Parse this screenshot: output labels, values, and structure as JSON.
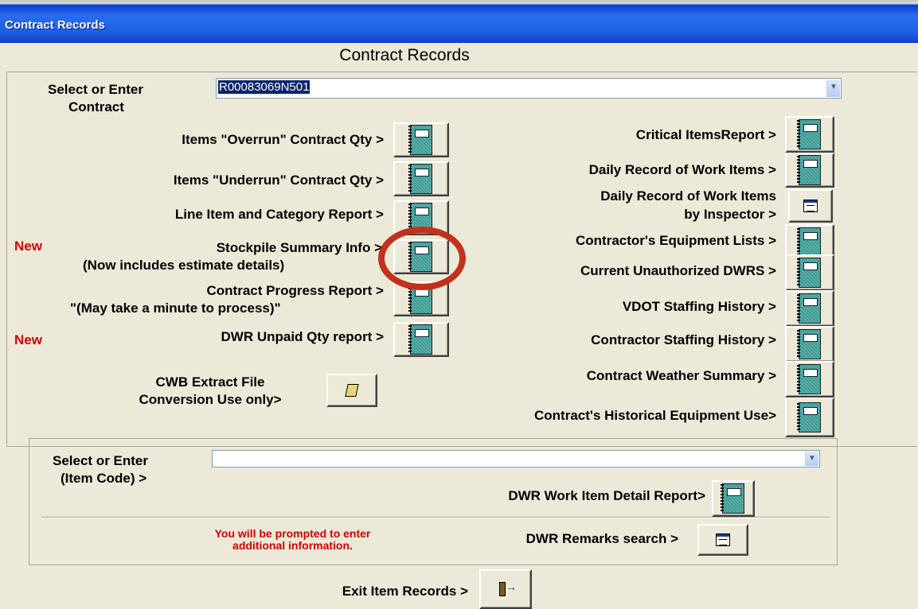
{
  "window": {
    "title": "Contract Records"
  },
  "form": {
    "heading": "Contract Records"
  },
  "contract_select": {
    "label_line1": "Select or Enter",
    "label_line2": "Contract",
    "value": "R00083069N501"
  },
  "left_buttons": {
    "overrun": "Items \"Overrun\" Contract Qty >",
    "underrun": "Items \"Underrun\" Contract Qty >",
    "line_item": "Line Item and Category Report >",
    "stockpile_line1": "Stockpile Summary Info >",
    "stockpile_line2": "(Now includes estimate details)",
    "progress_line1": "Contract Progress Report >",
    "progress_line2": "\"(May take a minute to process)\"",
    "unpaid": "DWR Unpaid Qty report >",
    "cwb_line1": "CWB Extract File",
    "cwb_line2": "Conversion Use only>"
  },
  "badges": {
    "new1": "New",
    "new2": "New"
  },
  "right_buttons": {
    "critical": "Critical ItemsReport >",
    "daily": "Daily Record of Work Items >",
    "daily_insp_line1": "Daily Record of Work Items",
    "daily_insp_line2": "by Inspector >",
    "equipment": "Contractor's Equipment Lists >",
    "unauthorized": "Current Unauthorized DWRS >",
    "vdot_staff": "VDOT Staffing History >",
    "contractor_staff": "Contractor Staffing History >",
    "weather": "Contract Weather Summary >",
    "historical": "Contract's Historical Equipment Use>"
  },
  "item_section": {
    "label_line1": "Select or Enter",
    "label_line2": "(Item Code) >",
    "value": "",
    "detail_report": "DWR Work Item Detail Report>",
    "prompt_line1": "You will be prompted to enter",
    "prompt_line2": "additional information.",
    "remarks": "DWR Remarks search >"
  },
  "exit": {
    "label": "Exit Item Records >"
  },
  "colors": {
    "titlebar": "#0a3fd1",
    "background": "#ece9d8",
    "report_icon": "#52b0a8",
    "alert": "#d40000",
    "highlight_circle": "#c1311c"
  }
}
